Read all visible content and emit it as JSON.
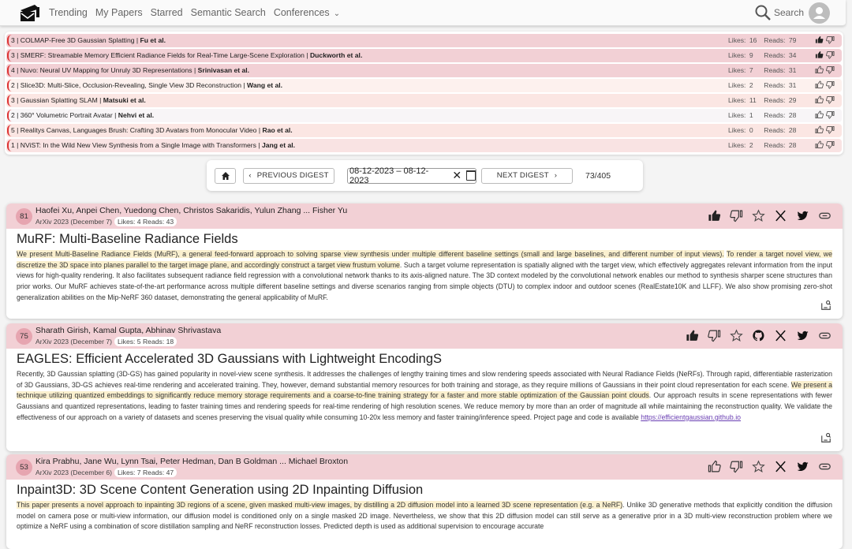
{
  "nav": {
    "items": [
      "Trending",
      "My Papers",
      "Starred",
      "Semantic Search",
      "Conferences"
    ],
    "search_label": "Search"
  },
  "digest": [
    {
      "score": "3",
      "title": "COLMAP-Free 3D Gaussian Splatting",
      "authors": "Fu et al.",
      "likes": "16",
      "reads": "79",
      "liked": true,
      "bg": "#f2d0d5"
    },
    {
      "score": "3",
      "title": "SMERF: Streamable Memory Efficient Radiance Fields for Real-Time Large-Scene Exploration",
      "authors": "Duckworth et al.",
      "likes": "9",
      "reads": "34",
      "liked": true,
      "bg": "#f2d0d5"
    },
    {
      "score": "4",
      "title": "Nuvo: Neural UV Mapping for Unruly 3D Representations",
      "authors": "Srinivasan et al.",
      "likes": "7",
      "reads": "31",
      "liked": false,
      "bg": "#f2d0d5"
    },
    {
      "score": "2",
      "title": "Slice3D: Multi-Slice, Occlusion-Revealing, Single View 3D Reconstruction",
      "authors": "Wang et al.",
      "likes": "2",
      "reads": "31",
      "liked": false,
      "bg": "#fdf1ee"
    },
    {
      "score": "3",
      "title": "Gaussian Splatting SLAM",
      "authors": "Matsuki et al.",
      "likes": "11",
      "reads": "29",
      "liked": false,
      "bg": "#fbe6e3"
    },
    {
      "score": "2",
      "title": "360° Volumetric Portrait Avatar",
      "authors": "Nehvi et al.",
      "likes": "1",
      "reads": "28",
      "liked": false,
      "bg": "#f8f5f7"
    },
    {
      "score": "5",
      "title": "Realitys Canvas, Languages Brush: Crafting 3D Avatars from Monocular Video",
      "authors": "Rao et al.",
      "likes": "0",
      "reads": "28",
      "liked": false,
      "bg": "#fbe6e3"
    },
    {
      "score": "1",
      "title": "NViST: In the Wild New View Synthesis from a Single Image with Transformers",
      "authors": "Jang et al.",
      "likes": "2",
      "reads": "28",
      "liked": false,
      "bg": "#f9e3e3"
    }
  ],
  "labels": {
    "likes": "Likes:",
    "reads": "Reads:",
    "sep": " | "
  },
  "controls": {
    "prev_label": "PREVIOUS DIGEST",
    "next_label": "NEXT DIGEST",
    "date_range": "08-12-2023 – 08-12-2023",
    "counter": "73/405"
  },
  "papers": [
    {
      "score": "81",
      "authors": "Haofei Xu, Anpei Chen, Yuedong Chen, Christos Sakaridis, Yulun Zhang ... Fisher Yu",
      "venue": "ArXiv 2023 (December 7)",
      "stats": "Likes: 4 Reads: 43",
      "title": "MuRF: Multi-Baseline Radiance Fields",
      "liked": true,
      "github": false,
      "abstract": [
        {
          "t": "We present Multi-Baseline Radiance Fields (MuRF), a general feed-forward approach to solving sparse view synthesis under multiple different baseline settings (small and large baselines, and different number of input views).",
          "h": true
        },
        {
          "t": " ",
          "h": false
        },
        {
          "t": "To render a target novel view, we discretize the 3D space into planes parallel to the target image plane, and accordingly construct a target view frustum volume",
          "h": true
        },
        {
          "t": ". Such a target volume representation is spatially aligned with the target view, which effectively aggregates relevant information from the input views for high-quality rendering. It also facilitates subsequent radiance field regression with a convolutional network thanks to its axis-aligned nature. The 3D context modeled by the convolutional network enables our method to synthesis sharper scene structures than prior works. Our MuRF achieves state-of-the-art performance across multiple different baseline settings and diverse scenarios ranging from simple objects (DTU) to complex indoor and outdoor scenes (RealEstate10K and LLFF). We also show promising zero-shot generalization abilities on the Mip-NeRF 360 dataset, demonstrating the general applicability of MuRF.",
          "h": false
        }
      ]
    },
    {
      "score": "75",
      "authors": "Sharath Girish, Kamal Gupta, Abhinav Shrivastava",
      "venue": "ArXiv 2023 (December 7)",
      "stats": "Likes: 5 Reads: 18",
      "title": "EAGLES: Efficient Accelerated 3D Gaussians with Lightweight EncodingS",
      "liked": true,
      "github": true,
      "abstract": [
        {
          "t": "Recently, 3D Gaussian splatting (3D-GS) has gained popularity in novel-view scene synthesis. It addresses the challenges of lengthy training times and slow rendering speeds associated with Neural Radiance Fields (NeRFs). Through rapid, differentiable rasterization of 3D Gaussians, 3D-GS achieves real-time rendering and accelerated training. They, however, demand substantial memory resources for both training and storage, as they require millions of Gaussians in their point cloud representation for each scene. ",
          "h": false
        },
        {
          "t": "We present a technique utilizing quantized embeddings to significantly reduce memory storage requirements and a coarse-to-fine training strategy for a faster and more stable optimization of the Gaussian point clouds",
          "h": true
        },
        {
          "t": ". Our approach results in scene representations with fewer Gaussians and quantized representations, leading to faster training times and rendering speeds for real-time rendering of high resolution scenes. We reduce memory by more than an order of magnitude all while maintaining the reconstruction quality. We validate the effectiveness of our approach on a variety of datasets and scenes preserving the visual quality while consuming 10-20x less memory and faster training/inference speed. Project page and code is available ",
          "h": false
        },
        {
          "t": "https://efficientgaussian.github.io",
          "h": false,
          "link": true
        }
      ]
    },
    {
      "score": "53",
      "authors": "Kira Prabhu, Jane Wu, Lynn Tsai, Peter Hedman, Dan B Goldman ... Michael Broxton",
      "venue": "ArXiv 2023 (December 6)",
      "stats": "Likes: 7 Reads: 47",
      "title": "Inpaint3D: 3D Scene Content Generation using 2D Inpainting Diffusion",
      "liked": false,
      "github": false,
      "abstract": [
        {
          "t": "This paper presents a novel approach to inpainting 3D regions of a scene, given masked multi-view images, by distilling a 2D diffusion model into a learned 3D scene representation (e.g. a NeRF)",
          "h": true
        },
        {
          "t": ". Unlike 3D generative methods that explicitly condition the diffusion model on camera pose or multi-view information, our diffusion model is conditioned only on a single masked 2D image. Nevertheless, we show that this 2D diffusion model can still serve as a generative prior in a 3D multi-view reconstruction problem where we optimize a NeRF using a combination of score distillation sampling and NeRF reconstruction losses. Predicted depth is used as additional supervision to encourage accurate",
          "h": false
        }
      ]
    }
  ]
}
